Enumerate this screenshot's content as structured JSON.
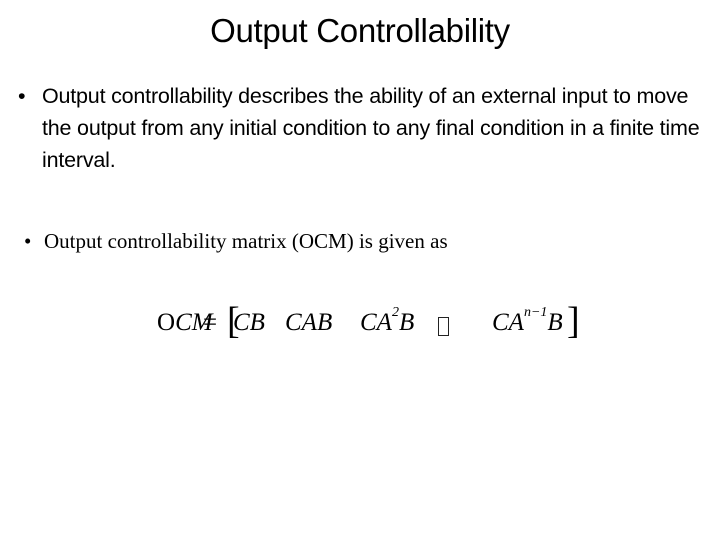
{
  "slide": {
    "title": "Output Controllability",
    "bullets": [
      {
        "marker": "•",
        "text": "Output controllability describes the ability of an external input to move the output from any initial condition to any final condition in a finite time interval."
      },
      {
        "marker": "•",
        "text": "Output controllability matrix (OCM) is given as"
      }
    ],
    "equation": {
      "lhs_o": "O",
      "lhs_rest": "CM",
      "equals": "=",
      "left_bracket": "[",
      "right_bracket": "]",
      "terms": [
        {
          "base": "CB",
          "sup": ""
        },
        {
          "base": "CAB",
          "sup": ""
        },
        {
          "base_pre": "CA",
          "sup": "2",
          "base_post": "B"
        },
        {
          "ellipsis_glyph": "missing-glyph-box"
        },
        {
          "base_pre": "CA",
          "sup": "n−1",
          "base_post": "B"
        }
      ]
    }
  }
}
